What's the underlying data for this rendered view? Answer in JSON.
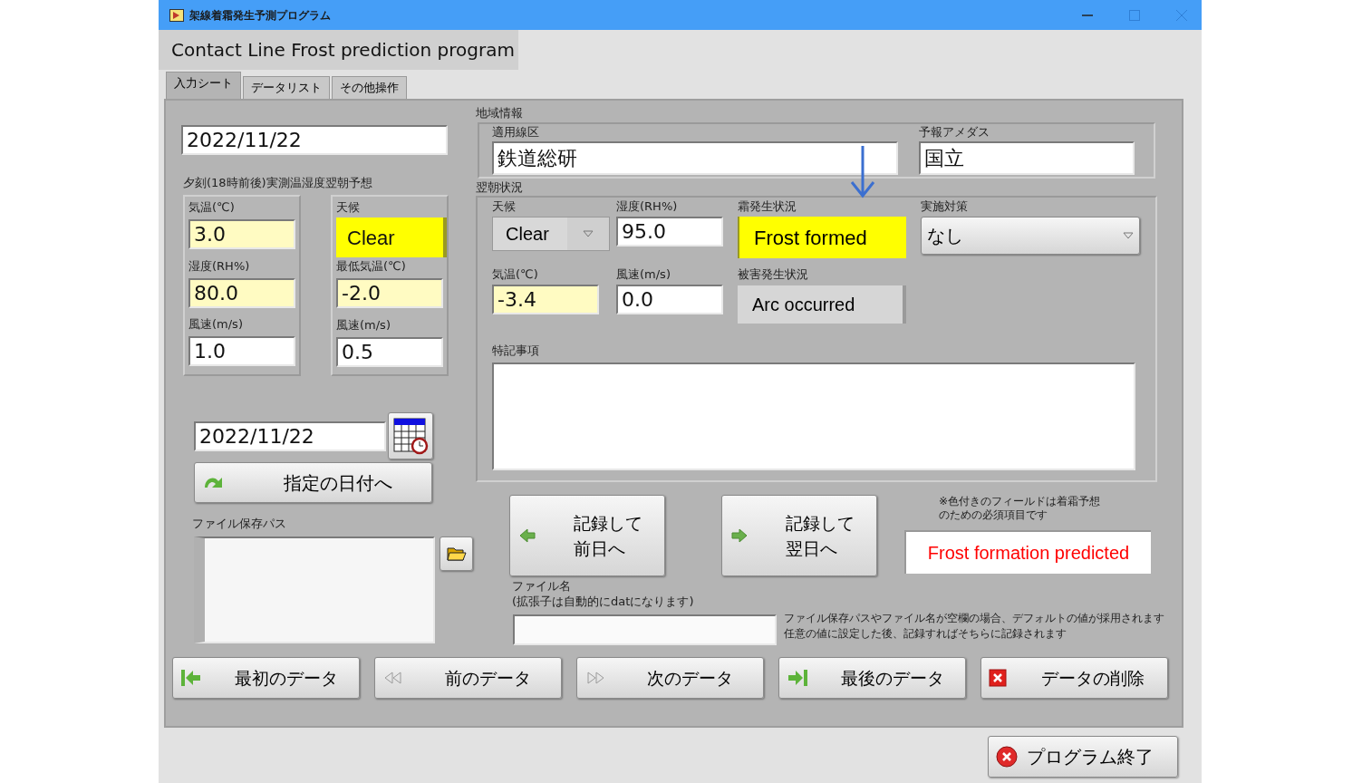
{
  "window": {
    "title": "架線着霜発生予測プログラム"
  },
  "heading": "Contact Line Frost prediction program",
  "tabs": [
    {
      "label": "入力シート",
      "selected": true
    },
    {
      "label": "データリスト",
      "selected": false
    },
    {
      "label": "その他操作",
      "selected": false
    }
  ],
  "date": "2022/11/22",
  "evening": {
    "title": "夕刻(18時前後)実測温湿度翌朝予想",
    "left": [
      {
        "label": "気温(℃)",
        "value": "3.0",
        "kind": "field",
        "required": true
      },
      {
        "label": "湿度(RH%)",
        "value": "80.0",
        "kind": "field",
        "required": true
      },
      {
        "label": "風速(m/s)",
        "value": "1.0",
        "kind": "field",
        "required": false
      }
    ],
    "right": [
      {
        "label": "天候",
        "value": "Clear",
        "kind": "indicator"
      },
      {
        "label": "最低気温(℃)",
        "value": "-2.0",
        "kind": "field",
        "required": true
      },
      {
        "label": "風速(m/s)",
        "value": "0.5",
        "kind": "field",
        "required": false
      }
    ]
  },
  "jump": {
    "date": "2022/11/22",
    "button": "指定の日付へ"
  },
  "file_path": {
    "label": "ファイル保存パス"
  },
  "region": {
    "title": "地域情報",
    "line": {
      "label": "適用線区",
      "value": "鉄道総研"
    },
    "amedas": {
      "label": "予報アメダス",
      "value": "国立"
    }
  },
  "morning": {
    "title": "翌朝状況",
    "weather": {
      "label": "天候",
      "value": "Clear"
    },
    "humidity": {
      "label": "湿度(RH%)",
      "value": "95.0",
      "required": false
    },
    "frost": {
      "label": "霜発生状況",
      "value": "Frost formed",
      "highlighted": true
    },
    "measure": {
      "label": "実施対策",
      "value": "なし"
    },
    "temperature": {
      "label": "気温(℃)",
      "value": "-3.4",
      "required": true
    },
    "wind": {
      "label": "風速(m/s)",
      "value": "0.0",
      "required": false
    },
    "damage": {
      "label": "被害発生状況",
      "value": "Arc occurred",
      "highlighted": false
    },
    "notes": {
      "label": "特記事項"
    }
  },
  "record_buttons": [
    {
      "lines": [
        "記録して",
        "前日へ"
      ],
      "kind": "back"
    },
    {
      "lines": [
        "記録して",
        "翌日へ"
      ],
      "kind": "forward"
    }
  ],
  "required_note": [
    "※色付きのフィールドは着霜予想",
    "のための必須項目です"
  ],
  "prediction": "Frost formation predicted",
  "file_name": {
    "label": [
      "ファイル名",
      "(拡張子は自動的にdatになります)"
    ]
  },
  "default_note": [
    "ファイル保存パスやファイル名が空欄の場合、デフォルトの値が採用されます",
    "任意の値に設定した後、記録すればそちらに記録されます"
  ],
  "nav_buttons": [
    {
      "label": "最初のデータ",
      "kind": "first"
    },
    {
      "label": "前のデータ",
      "kind": "prev"
    },
    {
      "label": "次のデータ",
      "kind": "next"
    },
    {
      "label": "最後のデータ",
      "kind": "last"
    },
    {
      "label": "データの削除",
      "kind": "delete"
    }
  ],
  "quit_button": "プログラム終了"
}
